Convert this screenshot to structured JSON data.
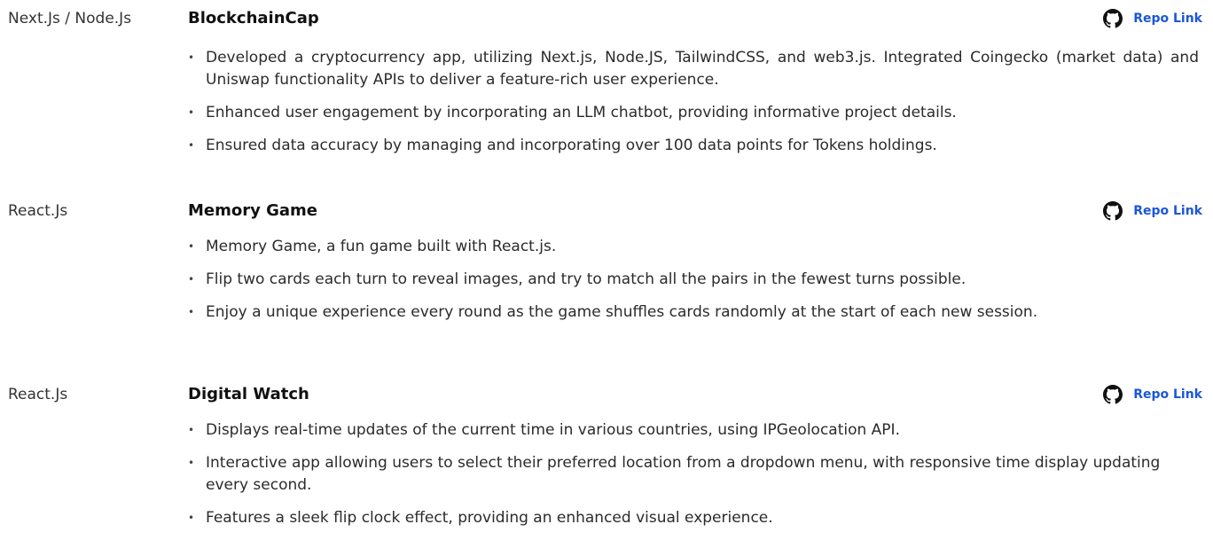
{
  "projects": [
    {
      "tech": "Next.Js / Node.Js",
      "title": "BlockchainCap",
      "repo_label": "Repo Link",
      "repo_icon": "github-icon",
      "bullets": [
        "Developed a cryptocurrency app, utilizing Next.js, Node.JS, TailwindCSS, and web3.js.  Integrated Coingecko (market data) and Uniswap functionality APIs to deliver a feature-rich user experience.",
        "Enhanced user engagement by incorporating an LLM chatbot, providing informative project details.",
        "Ensured data accuracy by managing and incorporating over 100 data points for Tokens holdings."
      ]
    },
    {
      "tech": "React.Js",
      "title": "Memory Game",
      "repo_label": "Repo Link",
      "repo_icon": "github-icon",
      "bullets": [
        "Memory Game, a fun game built with React.js.",
        "Flip two cards each turn to reveal images, and try to match all the pairs in the fewest turns possible.",
        "Enjoy a unique experience every round as the game shuffles cards randomly at the start of each new session."
      ]
    },
    {
      "tech": "React.Js",
      "title": "Digital Watch",
      "repo_label": "Repo Link",
      "repo_icon": "github-icon",
      "bullets": [
        "Displays real-time updates of the current time in various countries, using IPGeolocation API.",
        "Interactive app allowing users to select their preferred location from a dropdown menu, with responsive time display updating every second.",
        "Features a sleek flip clock effect, providing an enhanced visual experience."
      ]
    }
  ],
  "colors": {
    "link": "#1a56db",
    "text": "#222222"
  }
}
